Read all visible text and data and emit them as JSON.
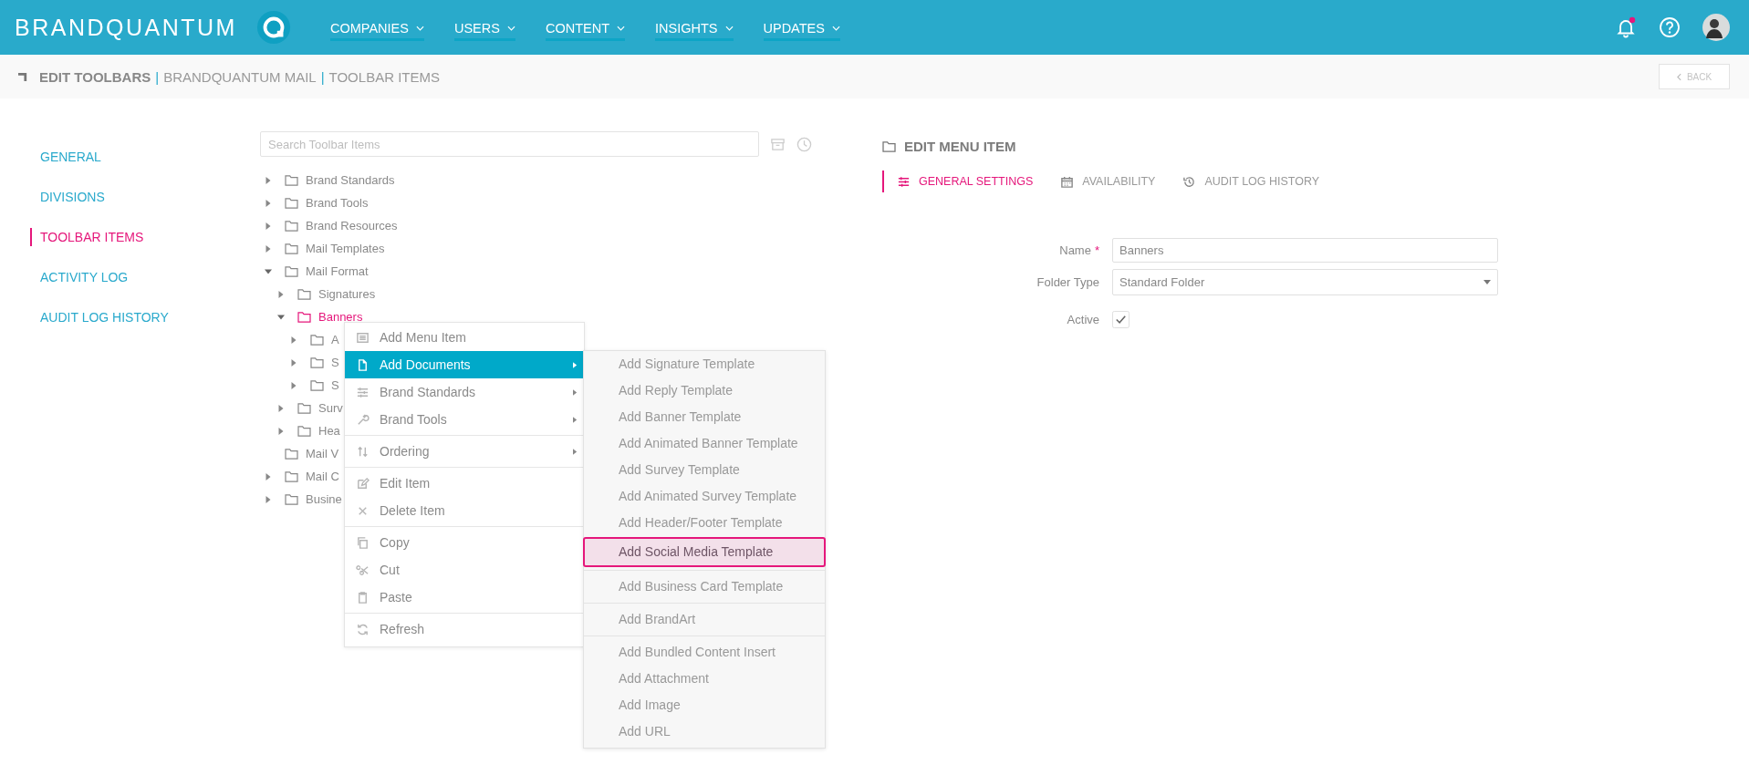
{
  "topbar": {
    "brand": "BRANDQUANTUM",
    "nav": [
      {
        "label": "COMPANIES"
      },
      {
        "label": "USERS"
      },
      {
        "label": "CONTENT"
      },
      {
        "label": "INSIGHTS"
      },
      {
        "label": "UPDATES"
      }
    ],
    "has_unread": true
  },
  "header": {
    "breadcrumb": [
      {
        "kind": "title",
        "text": "EDIT TOOLBARS"
      },
      {
        "kind": "separator",
        "text": "|"
      },
      {
        "kind": "crumb",
        "text": "BRANDQUANTUM MAIL"
      },
      {
        "kind": "separator",
        "text": "|"
      },
      {
        "kind": "crumb",
        "text": "TOOLBAR ITEMS"
      }
    ],
    "back_button": "BACK"
  },
  "sidebar": {
    "items": [
      {
        "label": "GENERAL",
        "selected": false
      },
      {
        "label": "DIVISIONS",
        "selected": false
      },
      {
        "label": "TOOLBAR ITEMS",
        "selected": true
      },
      {
        "label": "ACTIVITY LOG",
        "selected": false
      },
      {
        "label": "AUDIT LOG HISTORY",
        "selected": false
      }
    ]
  },
  "tree": {
    "search_placeholder": "Search Toolbar Items",
    "nodes": [
      {
        "label": "Brand Standards",
        "expandable": true,
        "expanded": false,
        "selected": false
      },
      {
        "label": "Brand Tools",
        "expandable": true,
        "expanded": false,
        "selected": false
      },
      {
        "label": "Brand Resources",
        "expandable": true,
        "expanded": false,
        "selected": false
      },
      {
        "label": "Mail Templates",
        "expandable": true,
        "expanded": false,
        "selected": false
      },
      {
        "label": "Mail Format",
        "expandable": true,
        "expanded": true,
        "selected": false,
        "children": [
          {
            "label": "Signatures",
            "expandable": true,
            "expanded": false,
            "selected": false
          },
          {
            "label": "Banners",
            "expandable": true,
            "expanded": true,
            "selected": true,
            "children": [
              {
                "label": "A",
                "expandable": true,
                "expanded": false,
                "selected": false
              },
              {
                "label": "S",
                "expandable": true,
                "expanded": false,
                "selected": false
              },
              {
                "label": "S",
                "expandable": true,
                "expanded": false,
                "selected": false
              }
            ]
          },
          {
            "label": "Surv",
            "expandable": true,
            "expanded": false,
            "selected": false
          },
          {
            "label": "Hea",
            "expandable": true,
            "expanded": false,
            "selected": false
          }
        ]
      },
      {
        "label": "Mail V",
        "expandable": false,
        "selected": false
      },
      {
        "label": "Mail C",
        "expandable": true,
        "expanded": false,
        "selected": false
      },
      {
        "label": "Busine",
        "expandable": true,
        "expanded": false,
        "selected": false
      }
    ]
  },
  "context_menu": {
    "groups": [
      [
        {
          "label": "Add Menu Item",
          "submenu": false,
          "selected": false
        },
        {
          "label": "Add Documents",
          "submenu": true,
          "selected": true
        },
        {
          "label": "Brand Standards",
          "submenu": true,
          "selected": false
        },
        {
          "label": "Brand Tools",
          "submenu": true,
          "selected": false
        }
      ],
      [
        {
          "label": "Ordering",
          "submenu": true,
          "selected": false
        }
      ],
      [
        {
          "label": "Edit Item",
          "submenu": false,
          "selected": false
        },
        {
          "label": "Delete Item",
          "submenu": false,
          "selected": false
        }
      ],
      [
        {
          "label": "Copy",
          "submenu": false,
          "selected": false
        },
        {
          "label": "Cut",
          "submenu": false,
          "selected": false
        },
        {
          "label": "Paste",
          "submenu": false,
          "selected": false
        }
      ],
      [
        {
          "label": "Refresh",
          "submenu": false,
          "selected": false
        }
      ]
    ]
  },
  "submenu": {
    "groups": [
      [
        {
          "label": "Add Signature Template",
          "selected": false
        },
        {
          "label": "Add Reply Template",
          "selected": false
        },
        {
          "label": "Add Banner Template",
          "selected": false
        },
        {
          "label": "Add Animated Banner Template",
          "selected": false
        },
        {
          "label": "Add Survey Template",
          "selected": false
        },
        {
          "label": "Add Animated Survey Template",
          "selected": false
        },
        {
          "label": "Add Header/Footer Template",
          "selected": false
        },
        {
          "label": "Add Social Media Template",
          "selected": true
        }
      ],
      [
        {
          "label": "Add Business Card Template",
          "selected": false
        }
      ],
      [
        {
          "label": "Add BrandArt",
          "selected": false
        }
      ],
      [
        {
          "label": "Add Bundled Content Insert",
          "selected": false
        },
        {
          "label": "Add Attachment",
          "selected": false
        },
        {
          "label": "Add Image",
          "selected": false
        },
        {
          "label": "Add URL",
          "selected": false
        }
      ]
    ]
  },
  "editor": {
    "title": "EDIT MENU ITEM",
    "tabs": [
      {
        "label": "GENERAL SETTINGS",
        "selected": true
      },
      {
        "label": "AVAILABILITY",
        "selected": false
      },
      {
        "label": "AUDIT LOG HISTORY",
        "selected": false
      }
    ],
    "fields": [
      {
        "kind": "text",
        "label": "Name",
        "required_mark": "*",
        "value": "Banners"
      },
      {
        "kind": "select",
        "label": "Folder Type",
        "value": "Standard Folder"
      },
      {
        "kind": "checkbox",
        "label": "Active",
        "checked": true
      }
    ]
  }
}
